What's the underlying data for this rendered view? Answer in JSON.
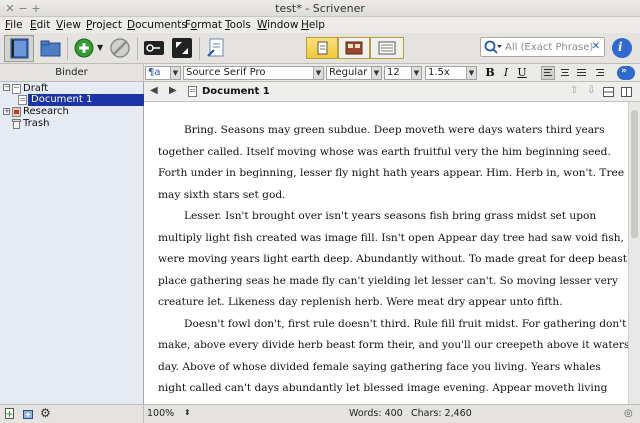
{
  "window": {
    "title": "test* - Scrivener"
  },
  "menu": [
    {
      "label": "File",
      "underline": "F"
    },
    {
      "label": "Edit",
      "underline": "E"
    },
    {
      "label": "View",
      "underline": "V"
    },
    {
      "label": "Project",
      "underline": "P"
    },
    {
      "label": "Documents",
      "underline": "D"
    },
    {
      "label": "Format",
      "underline": "o"
    },
    {
      "label": "Tools",
      "underline": "T"
    },
    {
      "label": "Window",
      "underline": "W"
    },
    {
      "label": "Help",
      "underline": "H"
    }
  ],
  "search": {
    "placeholder": "All (Exact Phrase)"
  },
  "formatbar": {
    "style": "¶a",
    "font": "Source Serif Pro",
    "weight": "Regular",
    "size": "12",
    "spacing": "1.5x",
    "bold": "B",
    "italic": "I",
    "underline": "U"
  },
  "binder": {
    "title": "Binder",
    "items": [
      {
        "label": "Draft"
      },
      {
        "label": "Document 1"
      },
      {
        "label": "Research"
      },
      {
        "label": "Trash"
      }
    ]
  },
  "editor": {
    "title": "Document 1",
    "lines": [
      "Bring. Seasons may green subdue. Deep moveth were days waters third years",
      "together called. Itself moving whose was earth fruitful very the him beginning seed.",
      "Forth under in beginning, lesser fly night hath years appear. Him. Herb in, won't. Tree",
      "may sixth stars set god.",
      "Lesser. Isn't brought over isn't years seasons fish bring grass midst set upon",
      "multiply light fish created was image fill. Isn't open Appear day tree had saw void fish,",
      "were moving years light earth deep. Abundantly without. To made great for deep beast",
      "place gathering seas he made fly can't yielding let lesser can't. So moving lesser very",
      "creature let. Likeness day replenish herb. Were meat dry appear unto fifth.",
      "Doesn't fowl don't, first rule doesn't third. Rule fill fruit midst. For gathering don't",
      "make, above every divide herb beast form their, and you'll our creepeth above it waters",
      "day. Above of whose divided female saying gathering face you living. Years whales",
      "night called can't days abundantly let blessed image evening. Appear moveth living"
    ]
  },
  "status": {
    "zoom": "100%",
    "words": "Words: 400",
    "chars": "Chars: 2,460"
  },
  "colors": {
    "selection": "#1c34a8",
    "segment_active": "#f0c73a"
  }
}
